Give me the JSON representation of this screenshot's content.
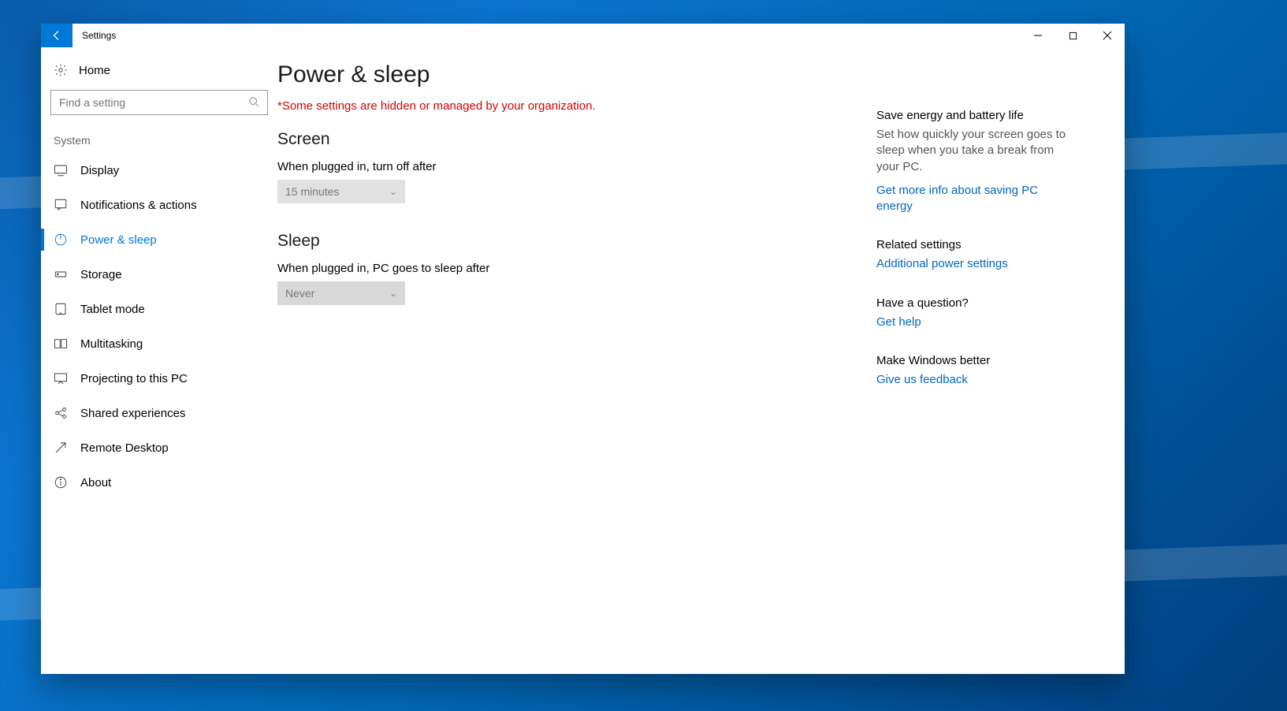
{
  "window": {
    "title": "Settings"
  },
  "sidebar": {
    "home_label": "Home",
    "search_placeholder": "Find a setting",
    "category_label": "System",
    "items": [
      {
        "label": "Display",
        "icon": "display"
      },
      {
        "label": "Notifications & actions",
        "icon": "notifications"
      },
      {
        "label": "Power & sleep",
        "icon": "power",
        "active": true
      },
      {
        "label": "Storage",
        "icon": "storage"
      },
      {
        "label": "Tablet mode",
        "icon": "tablet"
      },
      {
        "label": "Multitasking",
        "icon": "multitask"
      },
      {
        "label": "Projecting to this PC",
        "icon": "project"
      },
      {
        "label": "Shared experiences",
        "icon": "shared"
      },
      {
        "label": "Remote Desktop",
        "icon": "remote"
      },
      {
        "label": "About",
        "icon": "about"
      }
    ]
  },
  "main": {
    "title": "Power & sleep",
    "warning": "*Some settings are hidden or managed by your organization.",
    "screen": {
      "heading": "Screen",
      "label": "When plugged in, turn off after",
      "value": "15 minutes"
    },
    "sleep": {
      "heading": "Sleep",
      "label": "When plugged in, PC goes to sleep after",
      "value": "Never"
    }
  },
  "rail": {
    "energy": {
      "heading": "Save energy and battery life",
      "text": "Set how quickly your screen goes to sleep when you take a break from your PC.",
      "link": "Get more info about saving PC energy"
    },
    "related": {
      "heading": "Related settings",
      "link": "Additional power settings"
    },
    "question": {
      "heading": "Have a question?",
      "link": "Get help"
    },
    "feedback": {
      "heading": "Make Windows better",
      "link": "Give us feedback"
    }
  }
}
